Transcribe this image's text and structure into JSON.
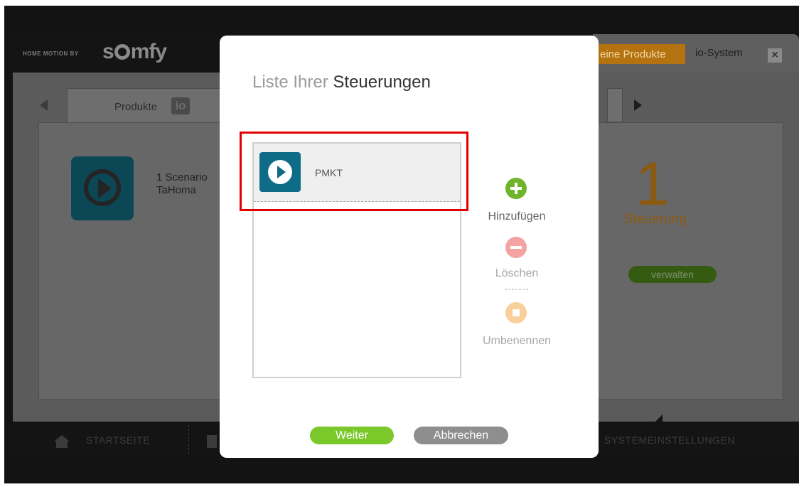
{
  "brand": {
    "tagline": "HOME MOTION BY",
    "logo_text": "somfy"
  },
  "topbar": {
    "products_link": "eine Produkte",
    "io_system_link": "io-System",
    "close_label": "×"
  },
  "tabs": {
    "products_label": "Produkte",
    "io_badge": "io"
  },
  "background_content": {
    "scenario_line1": "1 Scenario",
    "scenario_line2": "TaHoma",
    "count": "1",
    "count_label": "Steuerung",
    "manage_button": "verwalten"
  },
  "bottom_nav": {
    "start": "STARTSEITE",
    "settings": "SYSTEMEINSTELLUNGEN"
  },
  "modal": {
    "title_light": "Liste Ihrer",
    "title_bold": "Steuerungen",
    "list_items": [
      {
        "label": "PMKT",
        "icon": "play-icon"
      }
    ],
    "actions": {
      "add": "Hinzufügen",
      "delete": "Löschen",
      "separator": "-------",
      "rename": "Umbenennen"
    },
    "buttons": {
      "next": "Weiter",
      "cancel": "Abbrechen"
    }
  },
  "colors": {
    "accent_orange": "#b47210",
    "play_blue": "#0f6c86",
    "add_green": "#6fb52a",
    "highlight_red": "#e00000"
  }
}
